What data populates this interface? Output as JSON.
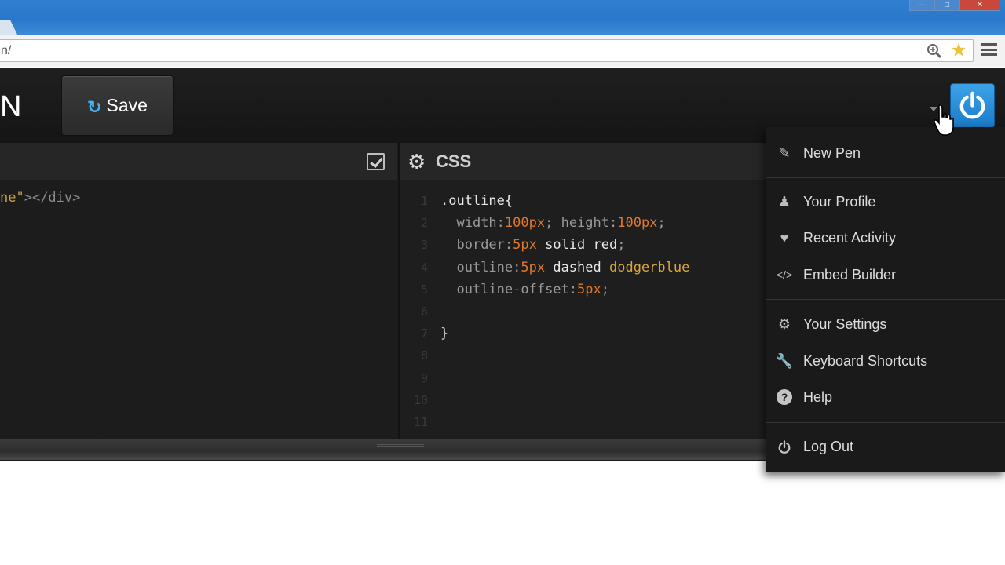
{
  "browser": {
    "url": "n/",
    "zoom_icon": "zoom-icon",
    "star_icon": "bookmark-star-icon",
    "menu_icon": "menu-icon"
  },
  "header": {
    "logo_fragment": "N",
    "save_label": "Save",
    "accent_color": "#47b2f0"
  },
  "html_editor": {
    "code_str": "ne\"",
    "code_tag": "></div>"
  },
  "css_editor": {
    "title": "CSS",
    "line_numbers": [
      "1",
      "2",
      "3",
      "4",
      "5",
      "6",
      "7",
      "8",
      "9",
      "10",
      "11"
    ],
    "lines": {
      "l1": ".outline{",
      "l2_p1": "width:",
      "l2_v1": "100px",
      "l2_s1": ";",
      "l2_p2": " height:",
      "l2_v2": "100px",
      "l2_s2": ";",
      "l3_p": "border:",
      "l3_v": "5px",
      "l3_k": " solid red",
      "l3_s": ";",
      "l4_p": "outline:",
      "l4_v": "5px",
      "l4_k": " dashed ",
      "l4_c": "dodgerblue",
      "l5_p": "outline-offset:",
      "l5_v": "5px",
      "l5_s": ";",
      "l7": "}"
    }
  },
  "dropdown": {
    "items": [
      {
        "label": "New Pen",
        "icon": "pencil-icon"
      },
      {
        "label": "Your Profile",
        "icon": "user-icon"
      },
      {
        "label": "Recent Activity",
        "icon": "heart-icon"
      },
      {
        "label": "Embed Builder",
        "icon": "code-icon"
      },
      {
        "label": "Your Settings",
        "icon": "gear-icon"
      },
      {
        "label": "Keyboard Shortcuts",
        "icon": "wrench-icon"
      },
      {
        "label": "Help",
        "icon": "help-icon"
      },
      {
        "label": "Log Out",
        "icon": "power-icon"
      }
    ]
  }
}
